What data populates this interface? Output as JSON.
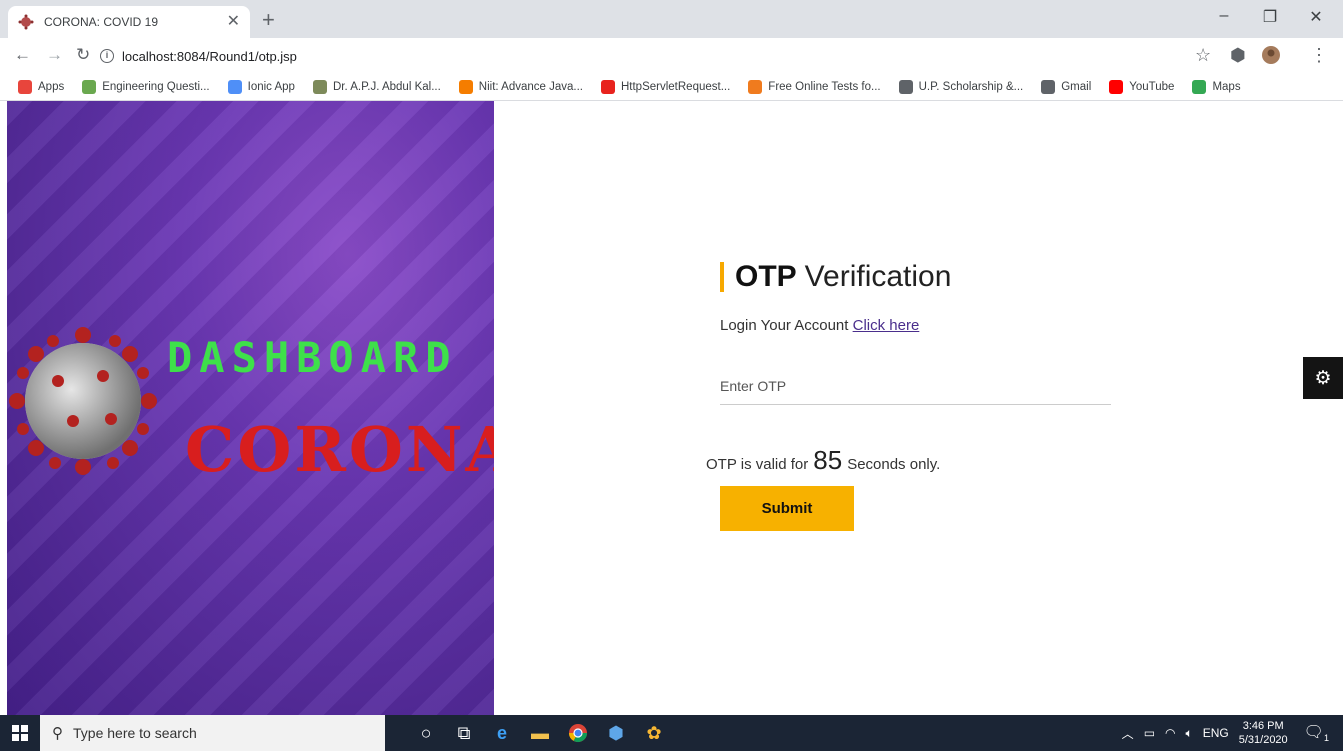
{
  "browser": {
    "tab_title": "CORONA: COVID 19",
    "url": "localhost:8084/Round1/otp.jsp",
    "bookmarks": [
      {
        "label": "Apps",
        "icon": "apps-grid-icon",
        "color": "#e8453c"
      },
      {
        "label": "Engineering Questi...",
        "icon": "engineering-site-icon",
        "color": "#6aa84f"
      },
      {
        "label": "Ionic App",
        "icon": "ionic-icon",
        "color": "#4f8ff7"
      },
      {
        "label": "Dr. A.P.J. Abdul Kal...",
        "icon": "portrait-icon",
        "color": "#7d8a5a"
      },
      {
        "label": "Niit: Advance Java...",
        "icon": "blogger-icon",
        "color": "#f57d00"
      },
      {
        "label": "HttpServletRequest...",
        "icon": "oracle-icon",
        "color": "#e8231e"
      },
      {
        "label": "Free Online Tests fo...",
        "icon": "tests-icon",
        "color": "#f07b1e"
      },
      {
        "label": "U.P. Scholarship &...",
        "icon": "globe-icon",
        "color": "#5f6368"
      },
      {
        "label": "Gmail",
        "icon": "globe-icon",
        "color": "#5f6368"
      },
      {
        "label": "YouTube",
        "icon": "youtube-icon",
        "color": "#ff0000"
      },
      {
        "label": "Maps",
        "icon": "maps-icon",
        "color": "#34a853"
      }
    ]
  },
  "hero": {
    "title_top": "DASHBOARD",
    "title_bottom": "CORONA"
  },
  "form": {
    "heading_bold": "OTP",
    "heading_light": "Verification",
    "login_text": "Login Your Account",
    "login_link": "Click here",
    "otp_placeholder": "Enter OTP",
    "validity_prefix": "OTP is valid for",
    "countdown": "85",
    "validity_suffix": "Seconds only.",
    "submit_label": "Submit"
  },
  "taskbar": {
    "search_placeholder": "Type here to search",
    "language": "ENG",
    "time": "3:46 PM",
    "date": "5/31/2020",
    "notifications": "1"
  },
  "colors": {
    "accent": "#f7b100",
    "hero_purple": "#6a37b4",
    "dashboard_green": "#3ee04a",
    "corona_red": "#d81e1e"
  }
}
